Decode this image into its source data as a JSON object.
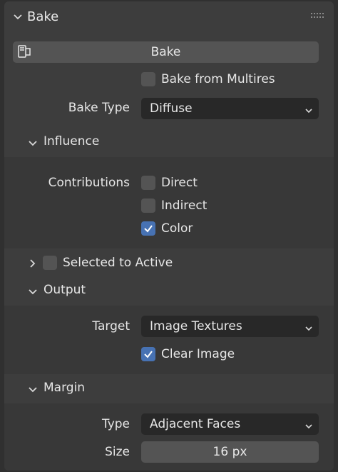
{
  "panel": {
    "title": "Bake",
    "bake_button_label": "Bake",
    "bake_from_multires": {
      "label": "Bake from Multires",
      "checked": false
    },
    "bake_type": {
      "label": "Bake Type",
      "value": "Diffuse"
    }
  },
  "influence": {
    "title": "Influence",
    "contributions_label": "Contributions",
    "direct": {
      "label": "Direct",
      "checked": false
    },
    "indirect": {
      "label": "Indirect",
      "checked": false
    },
    "color": {
      "label": "Color",
      "checked": true
    }
  },
  "selected_to_active": {
    "label": "Selected to Active",
    "checked": false
  },
  "output": {
    "title": "Output",
    "target_label": "Target",
    "target_value": "Image Textures",
    "clear_image": {
      "label": "Clear Image",
      "checked": true
    }
  },
  "margin": {
    "title": "Margin",
    "type_label": "Type",
    "type_value": "Adjacent Faces",
    "size_label": "Size",
    "size_value": "16 px"
  },
  "colors": {
    "background": "#303030",
    "panel": "#3d3d3d",
    "subsection": "#383838",
    "button": "#545454",
    "dropdown": "#282828",
    "checkbox_checked": "#4772b3"
  }
}
